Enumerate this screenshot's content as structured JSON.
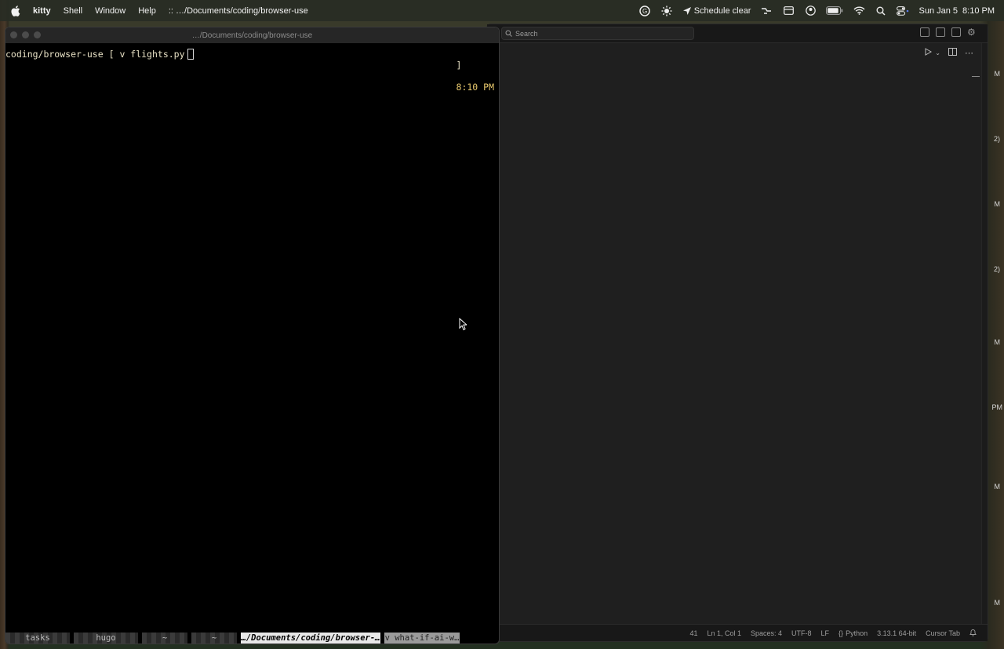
{
  "menubar": {
    "app": "kitty",
    "items": [
      "Shell",
      "Window",
      "Help"
    ],
    "window_path": ":: …/Documents/coding/browser-use",
    "schedule": "Schedule clear",
    "date": "Sun Jan 5",
    "time": "8:10 PM"
  },
  "kitty": {
    "title": "…/Documents/coding/browser-use",
    "prompt_path": "coding/browser-use",
    "prompt_open": "[",
    "command": "v flights.py",
    "right_bracket": "]",
    "right_time": "8:10 PM",
    "tabs": [
      {
        "label": "tasks",
        "state": "inactive"
      },
      {
        "label": "hugo",
        "state": "inactive"
      },
      {
        "label": "~",
        "state": "inactive"
      },
      {
        "label": "~",
        "state": "inactive"
      },
      {
        "label": "…/Documents/coding/browser-…",
        "state": "active"
      },
      {
        "label": "v what-if-ai-w…",
        "state": "last"
      }
    ]
  },
  "vscode": {
    "search_placeholder": "Search",
    "edge_text": [
      "M",
      "2)",
      "M",
      "2)",
      "M",
      "PM",
      "M",
      "M"
    ],
    "status": {
      "number": "41",
      "position": "Ln 1, Col 1",
      "spaces": "Spaces: 4",
      "encoding": "UTF-8",
      "eol": "LF",
      "language": "Python",
      "interpreter": "3.13.1 64-bit",
      "cursor_tab": "Cursor Tab"
    }
  }
}
